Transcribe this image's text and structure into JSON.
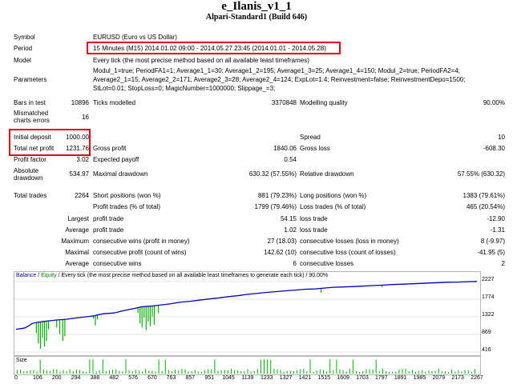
{
  "report": {
    "title": "e_Ilanis_v1_1",
    "subtitle": "Alpari-Standard1 (Build 646)"
  },
  "summary": {
    "symbol_label": "Symbol",
    "symbol_value": "EURUSD (Euro vs US Dollar)",
    "period_label": "Period",
    "period_value": "15 Minutes (M15) 2014.01.02 09:00 - 2014.05.27 23:45 (2014.01.01 - 2014.05.28)",
    "model_label": "Model",
    "model_value": "Every tick (the most precise method based on all available least timeframes)",
    "parameters_label": "Parameters",
    "parameters_line1": "Modul_1=true; PeriodFA1=1; Average1_1=30; Average1_2=195; Average1_3=25; Average1_4=150; Modul_2=true; PeriodFA2=4;",
    "parameters_line2": "Average2_1=15; Average2_2=171; Average2_3=28; Average2_4=124; ExpLot=1.4; Reinvestment=false; ReinvestmentDepo=1500;",
    "parameters_line3": "StLot=0.01; StopLoss=0; MagicNumber=1000000; Slippage_=3;"
  },
  "stats": {
    "bars_label": "Bars in test",
    "bars_value": "10896",
    "ticks_label": "Ticks modelled",
    "ticks_value": "3370848",
    "quality_label": "Modelling quality",
    "quality_value": "90.00%",
    "mismatch_label1": "Mismatched",
    "mismatch_label2": "charts errors",
    "mismatch_value": "16",
    "initial_label": "Initial deposit",
    "initial_value": "1000.00",
    "spread_label": "Spread",
    "spread_value": "10",
    "net_label": "Total net profit",
    "net_value": "1231.76",
    "gross_profit_label": "Gross profit",
    "gross_profit_value": "1840.06",
    "gross_loss_label": "Gross loss",
    "gross_loss_value": "-608.30",
    "pf_label": "Profit factor",
    "pf_value": "3.02",
    "payoff_label": "Expected payoff",
    "payoff_value": "0.54",
    "abs_dd_label1": "Absolute",
    "abs_dd_label2": "drawdown",
    "abs_dd_value": "534.97",
    "max_dd_label": "Maximal drawdown",
    "max_dd_value": "630.32 (57.55%)",
    "rel_dd_label": "Relative drawdown",
    "rel_dd_value": "57.55% (630.32)",
    "trades_label": "Total trades",
    "trades_value": "2264",
    "short_label": "Short positions (won %)",
    "short_value": "881 (79.23%)",
    "long_label": "Long positions (won %)",
    "long_value": "1383 (79.61%)",
    "profit_trades_label": "Profit trades (% of total)",
    "profit_trades_value": "1799 (79.46%)",
    "loss_trades_label": "Loss trades (% of total)",
    "loss_trades_value": "465 (20.54%)",
    "largest_label": "Largest",
    "largest_profit_label": "profit trade",
    "largest_profit_value": "54.15",
    "largest_loss_label": "loss trade",
    "largest_loss_value": "-12.90",
    "average_label": "Average",
    "average_profit_label": "profit trade",
    "average_profit_value": "1.02",
    "average_loss_label": "loss trade",
    "average_loss_value": "-1.31",
    "maximum_label": "Maximum",
    "max_wins_label": "consecutive wins (profit in money)",
    "max_wins_value": "27 (18.03)",
    "max_losses_label": "consecutive losses (loss in money)",
    "max_losses_value": "8 (-9.97)",
    "maximal_label": "Maximal",
    "maximal_profit_label": "consecutive profit (count of wins)",
    "maximal_profit_value": "142.62 (10)",
    "maximal_loss_label": "consecutive loss (count of losses)",
    "maximal_loss_value": "-41.95 (5)",
    "average2_label": "Average",
    "avg_wins_label": "consecutive wins",
    "avg_wins_value": "6",
    "avg_losses_label": "consecutive losses",
    "avg_losses_value": "2"
  },
  "chart_data": {
    "type": "line",
    "legend": [
      "Balance",
      "Equity"
    ],
    "legend_text": "/ Every tick (the most precise method based on all available least timeframes to generate each tick) / 90.00%",
    "x_ticks": [
      "0",
      "106",
      "200",
      "294",
      "388",
      "482",
      "576",
      "670",
      "763",
      "857",
      "951",
      "1045",
      "1139",
      "1233",
      "1327",
      "1421",
      "1515",
      "1609",
      "1703",
      "1797",
      "1891",
      "1985",
      "2079",
      "2173",
      "2267"
    ],
    "y_ticks": [
      "2227",
      "1774",
      "1322",
      "869",
      "416"
    ],
    "ylim": [
      416,
      2227
    ],
    "xlim": [
      0,
      2267
    ],
    "balance_x": [
      0,
      40,
      60,
      80,
      106,
      150,
      200,
      250,
      294,
      340,
      388,
      400,
      430,
      482,
      530,
      576,
      620,
      670,
      720,
      763,
      810,
      857,
      900,
      951,
      1000,
      1045,
      1100,
      1139,
      1180,
      1233,
      1280,
      1327,
      1380,
      1421,
      1470,
      1515,
      1560,
      1609,
      1660,
      1703,
      1750,
      1797,
      1850,
      1891,
      1940,
      1985,
      2030,
      2079,
      2120,
      2173,
      2220,
      2267
    ],
    "balance_y": [
      1000,
      1030,
      1080,
      1150,
      1180,
      1210,
      1240,
      1260,
      1290,
      1320,
      1350,
      1370,
      1400,
      1420,
      1480,
      1530,
      1580,
      1600,
      1630,
      1660,
      1700,
      1720,
      1750,
      1780,
      1810,
      1840,
      1870,
      1900,
      1920,
      1950,
      1970,
      1990,
      2010,
      2030,
      2040,
      2060,
      2080,
      2090,
      2100,
      2110,
      2125,
      2135,
      2150,
      2160,
      2170,
      2180,
      2190,
      2200,
      2210,
      2215,
      2225,
      2232
    ],
    "equity_dips_x": [
      100,
      110,
      120,
      130,
      140,
      150,
      160,
      200,
      215,
      230,
      240,
      380,
      390,
      400,
      600,
      610,
      620,
      630,
      640,
      650,
      660,
      670,
      680,
      700,
      1500,
      1800
    ],
    "equity_dips_y": [
      900,
      640,
      500,
      780,
      560,
      700,
      1000,
      1050,
      880,
      700,
      820,
      1280,
      1100,
      1250,
      1420,
      1150,
      1050,
      1300,
      980,
      1200,
      1080,
      1330,
      1120,
      1420,
      1940,
      2080
    ],
    "size_label": "Size"
  }
}
